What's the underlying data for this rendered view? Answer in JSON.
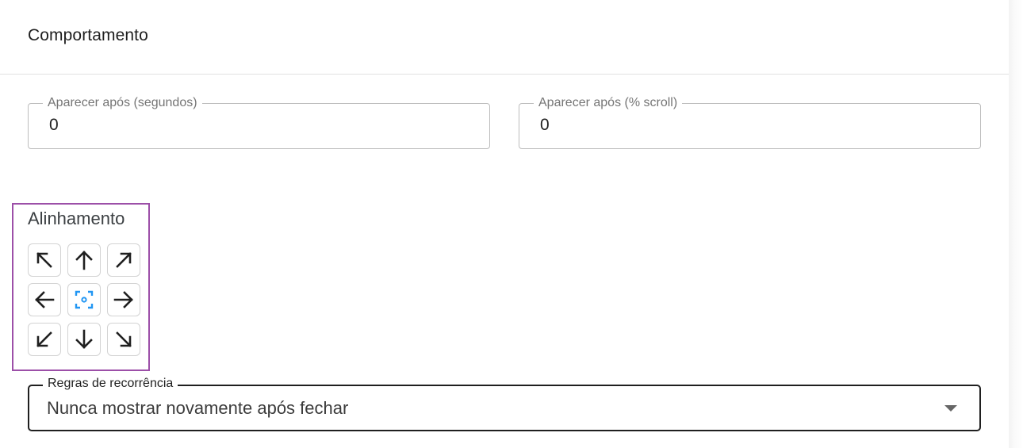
{
  "section": {
    "title": "Comportamento"
  },
  "fields": {
    "seconds": {
      "label": "Aparecer após (segundos)",
      "value": "0"
    },
    "scroll": {
      "label": "Aparecer após (% scroll)",
      "value": "0"
    }
  },
  "alignment": {
    "title": "Alinhamento",
    "selected": "center",
    "options": [
      "top-left",
      "top",
      "top-right",
      "left",
      "center",
      "right",
      "bottom-left",
      "bottom",
      "bottom-right"
    ],
    "selected_color": "#2196f3"
  },
  "recurrence": {
    "label": "Regras de recorrência",
    "value": "Nunca mostrar novamente após fechar"
  },
  "colors": {
    "highlight_border": "#9c4fa8",
    "icon": "#1f1f1f"
  }
}
